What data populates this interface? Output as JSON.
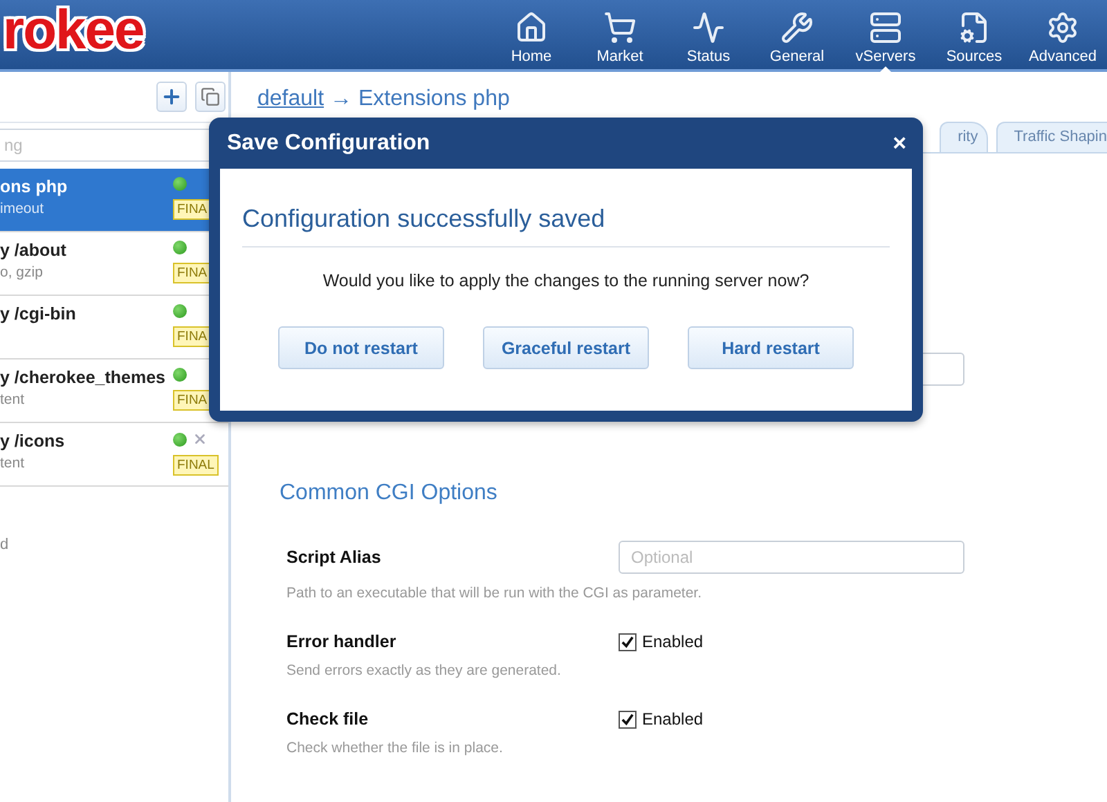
{
  "header": {
    "logo": "rokee",
    "nav": [
      {
        "label": "Home",
        "selected": false
      },
      {
        "label": "Market",
        "selected": false
      },
      {
        "label": "Status",
        "selected": false
      },
      {
        "label": "General",
        "selected": false
      },
      {
        "label": "vServers",
        "selected": true
      },
      {
        "label": "Sources",
        "selected": false
      },
      {
        "label": "Advanced",
        "selected": false
      }
    ]
  },
  "sidebar": {
    "search": {
      "placeholder": "ng"
    },
    "items": [
      {
        "title": "ons php",
        "subtitle": "imeout",
        "badge": "FINA",
        "selected": true,
        "hovered": false
      },
      {
        "title": "y /about",
        "subtitle": "o, gzip",
        "badge": "FINA",
        "selected": false,
        "hovered": false
      },
      {
        "title": "y /cgi-bin",
        "badge": "FINA",
        "selected": false,
        "hovered": false
      },
      {
        "title": "y /cherokee_themes",
        "subtitle": "tent",
        "badge": "FINA",
        "selected": false,
        "hovered": false
      },
      {
        "title": "y /icons",
        "subtitle": "tent",
        "badge": "FINAL",
        "selected": false,
        "hovered": true
      }
    ],
    "footer_text": "d"
  },
  "breadcrumb": {
    "link": "default",
    "arrow": "→",
    "current": "Extensions php"
  },
  "tabs": [
    {
      "label": "rity",
      "selected": false
    },
    {
      "label": "Traffic Shapin",
      "selected": false
    }
  ],
  "section": {
    "title": "Common CGI Options",
    "rows": [
      {
        "kind": "text",
        "label": "Script Alias",
        "placeholder": "Optional",
        "help": "Path to an executable that will be run with the CGI as parameter."
      },
      {
        "kind": "checkbox",
        "label": "Error handler",
        "option": "Enabled",
        "checked": true,
        "help": "Send errors exactly as they are generated."
      },
      {
        "kind": "checkbox",
        "label": "Check file",
        "option": "Enabled",
        "checked": true,
        "help": "Check whether the file is in place."
      }
    ]
  },
  "dialog": {
    "title": "Save Configuration",
    "close": "×",
    "heading": "Configuration successfully saved",
    "question": "Would you like to apply the changes to the running server now?",
    "buttons": [
      "Do not restart",
      "Graceful restart",
      "Hard restart"
    ]
  }
}
